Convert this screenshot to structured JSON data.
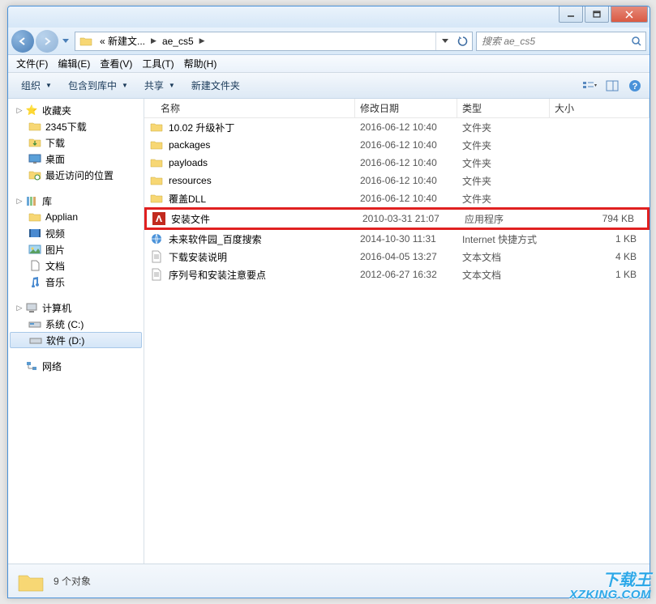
{
  "titlebar": {
    "min": "—",
    "max": "❐",
    "close": "✕"
  },
  "breadcrumb": {
    "seg1": "« 新建文...",
    "seg2": "ae_cs5"
  },
  "search": {
    "placeholder": "搜索 ae_cs5"
  },
  "menubar": [
    "文件(F)",
    "编辑(E)",
    "查看(V)",
    "工具(T)",
    "帮助(H)"
  ],
  "toolbar": {
    "organize": "组织",
    "include": "包含到库中",
    "share": "共享",
    "newfolder": "新建文件夹"
  },
  "columns": {
    "name": "名称",
    "date": "修改日期",
    "type": "类型",
    "size": "大小"
  },
  "sidebar": {
    "favorites": {
      "label": "收藏夹",
      "items": [
        "2345下载",
        "下载",
        "桌面",
        "最近访问的位置"
      ]
    },
    "library": {
      "label": "库",
      "items": [
        "Applian",
        "视频",
        "图片",
        "文档",
        "音乐"
      ]
    },
    "computer": {
      "label": "计算机",
      "items": [
        "系统 (C:)",
        "软件 (D:)"
      ]
    },
    "network": {
      "label": "网络"
    }
  },
  "files": [
    {
      "icon": "folder",
      "name": "10.02 升级补丁",
      "date": "2016-06-12 10:40",
      "type": "文件夹",
      "size": ""
    },
    {
      "icon": "folder",
      "name": "packages",
      "date": "2016-06-12 10:40",
      "type": "文件夹",
      "size": ""
    },
    {
      "icon": "folder",
      "name": "payloads",
      "date": "2016-06-12 10:40",
      "type": "文件夹",
      "size": ""
    },
    {
      "icon": "folder",
      "name": "resources",
      "date": "2016-06-12 10:40",
      "type": "文件夹",
      "size": ""
    },
    {
      "icon": "folder",
      "name": "覆盖DLL",
      "date": "2016-06-12 10:40",
      "type": "文件夹",
      "size": ""
    },
    {
      "icon": "adobe",
      "name": "安装文件",
      "date": "2010-03-31 21:07",
      "type": "应用程序",
      "size": "794 KB",
      "highlight": true
    },
    {
      "icon": "url",
      "name": "未来软件园_百度搜索",
      "date": "2014-10-30 11:31",
      "type": "Internet 快捷方式",
      "size": "1 KB"
    },
    {
      "icon": "txt",
      "name": "下载安装说明",
      "date": "2016-04-05 13:27",
      "type": "文本文档",
      "size": "4 KB"
    },
    {
      "icon": "txt",
      "name": "序列号和安装注意要点",
      "date": "2012-06-27 16:32",
      "type": "文本文档",
      "size": "1 KB"
    }
  ],
  "status": {
    "count": "9 个对象"
  },
  "watermark": {
    "l1": "下载王",
    "l2": "XZKING.COM"
  }
}
